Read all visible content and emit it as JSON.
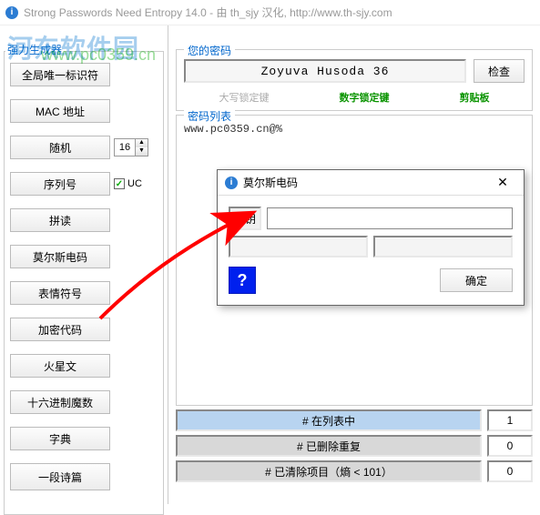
{
  "title": "Strong Passwords Need Entropy 14.0 - 由 th_sjy 汉化, http://www.th-sjy.com",
  "watermark_main": "河东软件园",
  "watermark_url": "www.pc0359.cn",
  "sidebar": {
    "group_label": "强力生成器",
    "items": [
      {
        "label": "全局唯一标识符"
      },
      {
        "label": "MAC 地址"
      },
      {
        "label": "随机"
      },
      {
        "label": "序列号"
      },
      {
        "label": "拼读"
      },
      {
        "label": "莫尔斯电码"
      },
      {
        "label": "表情符号"
      },
      {
        "label": "加密代码"
      },
      {
        "label": "火星文"
      },
      {
        "label": "十六进制魔数"
      },
      {
        "label": "字典"
      },
      {
        "label": "一段诗篇"
      }
    ],
    "spin_value": "16",
    "uc_label": "UC"
  },
  "top": {
    "group_label": "您的密码",
    "password": "Zoyuva Husoda 36",
    "check_label": "检查",
    "caps_label": "大写锁定键",
    "num_label": "数字锁定键",
    "clip_label": "剪贴板"
  },
  "mid": {
    "group_label": "密码列表",
    "content": "www.pc0359.cn@%"
  },
  "stats": {
    "row1_label": "# 在列表中",
    "row1_val": "1",
    "row2_label": "# 已删除重复",
    "row2_val": "0",
    "row3_label": "# 已清除项目（熵 < 101）",
    "row3_val": "0"
  },
  "dialog": {
    "title": "莫尔斯电码",
    "key_label": "密钥",
    "input_value": "",
    "help_label": "?",
    "ok_label": "确定"
  }
}
